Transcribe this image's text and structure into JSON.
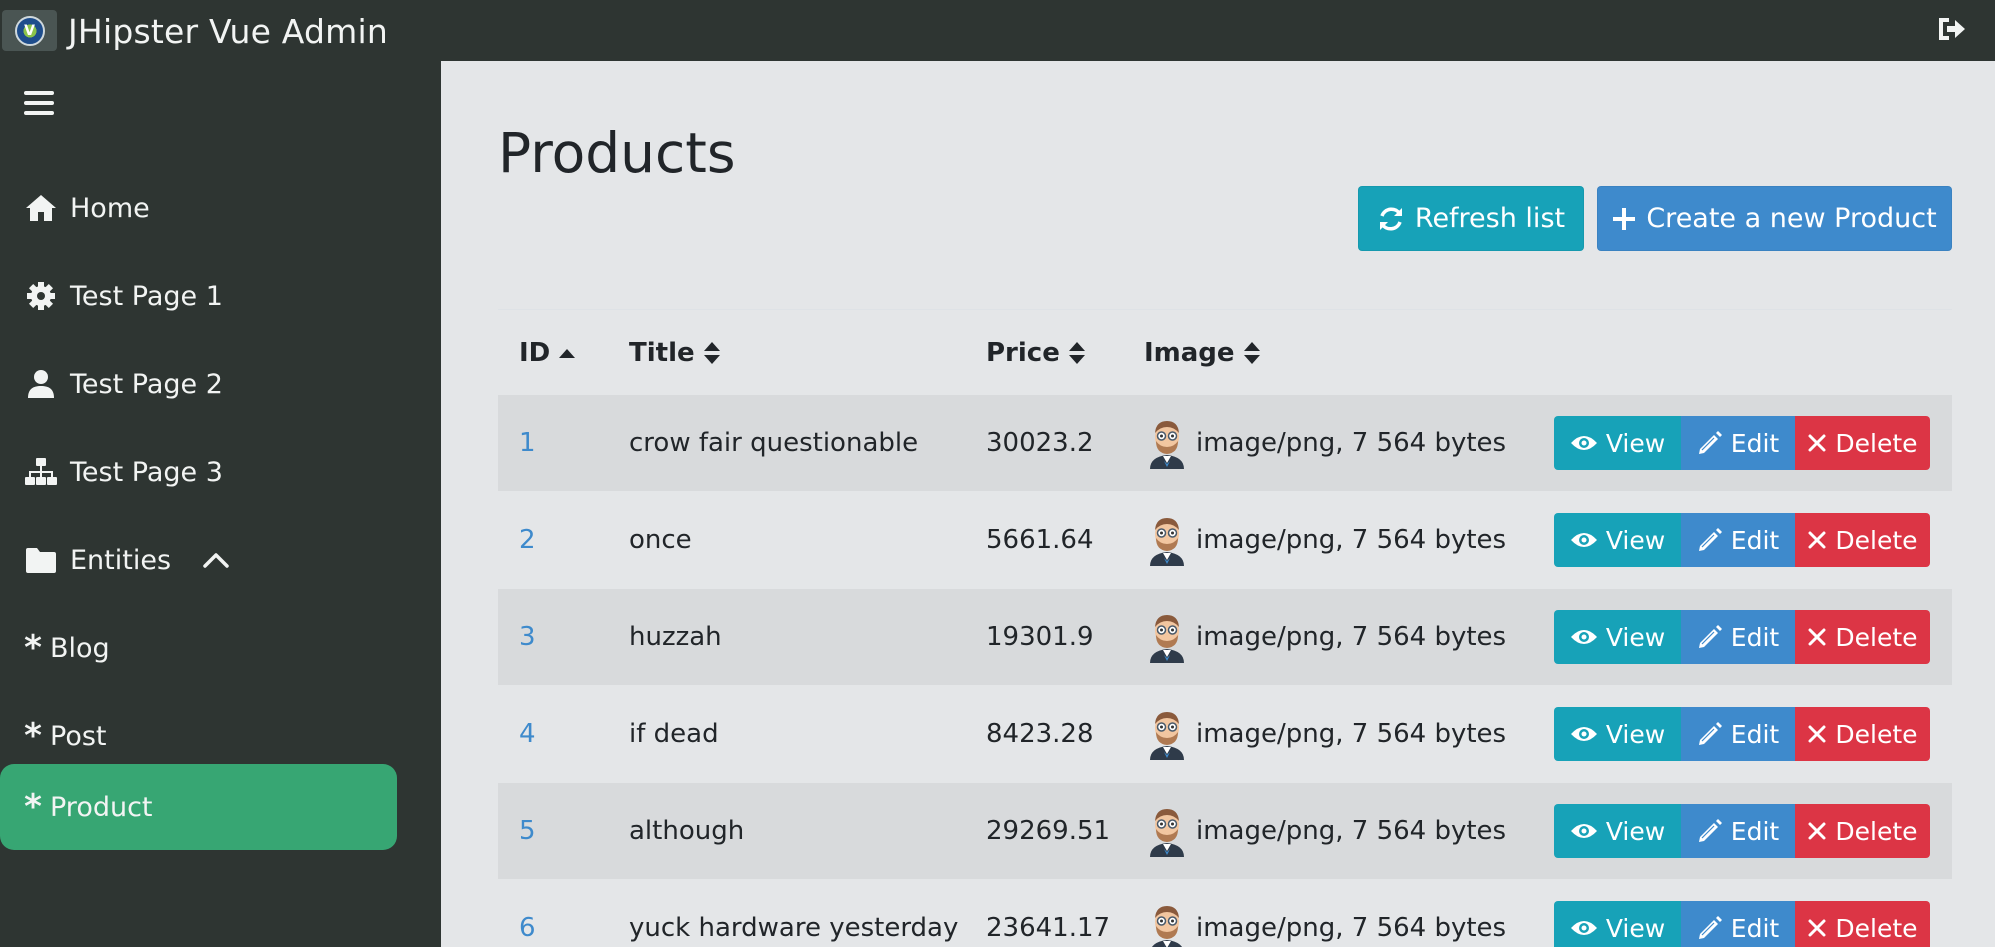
{
  "header": {
    "brand": "JHipster Vue Admin"
  },
  "sidebar": {
    "items": [
      {
        "label": "Home",
        "icon": "home-icon"
      },
      {
        "label": "Test Page 1",
        "icon": "gear-icon"
      },
      {
        "label": "Test Page 2",
        "icon": "user-icon"
      },
      {
        "label": "Test Page 3",
        "icon": "sitemap-icon"
      },
      {
        "label": "Entities",
        "icon": "folder-icon"
      },
      {
        "label": "Blog",
        "icon": "asterisk-icon"
      },
      {
        "label": "Post",
        "icon": "asterisk-icon"
      },
      {
        "label": "Product",
        "icon": "asterisk-icon",
        "active": true
      }
    ]
  },
  "main": {
    "title": "Products",
    "refresh_label": "Refresh list",
    "create_label": "Create a new Product",
    "columns": [
      "ID",
      "Title",
      "Price",
      "Image"
    ],
    "rows": [
      {
        "id": "1",
        "title": "crow fair questionable",
        "price": "30023.2",
        "image": "image/png, 7 564 bytes"
      },
      {
        "id": "2",
        "title": "once",
        "price": "5661.64",
        "image": "image/png, 7 564 bytes"
      },
      {
        "id": "3",
        "title": "huzzah",
        "price": "19301.9",
        "image": "image/png, 7 564 bytes"
      },
      {
        "id": "4",
        "title": "if dead",
        "price": "8423.28",
        "image": "image/png, 7 564 bytes"
      },
      {
        "id": "5",
        "title": "although",
        "price": "29269.51",
        "image": "image/png, 7 564 bytes"
      },
      {
        "id": "6",
        "title": "yuck hardware yesterday",
        "price": "23641.17",
        "image": "image/png, 7 564 bytes"
      }
    ],
    "actions": {
      "view": "View",
      "edit": "Edit",
      "delete": "Delete"
    }
  },
  "colors": {
    "topbar": "#2e3532",
    "active_nav": "#37a673",
    "info": "#17a2b8",
    "primary": "#3e8acc",
    "danger": "#dc3545"
  }
}
